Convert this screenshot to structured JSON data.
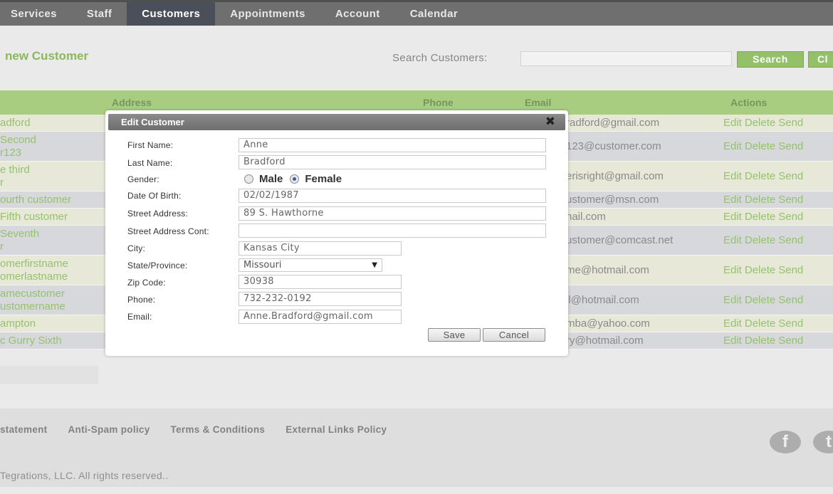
{
  "nav": {
    "items": [
      {
        "label": "Services",
        "active": false
      },
      {
        "label": "Staff",
        "active": false
      },
      {
        "label": "Customers",
        "active": true
      },
      {
        "label": "Appointments",
        "active": false
      },
      {
        "label": "Account",
        "active": false
      },
      {
        "label": "Calendar",
        "active": false
      }
    ]
  },
  "page": {
    "add_link": "new Customer",
    "search_label": "Search Customers:",
    "search_value": "",
    "search_button": "Search",
    "clear_button": "Cl"
  },
  "table": {
    "headers": {
      "address": "Address",
      "phone": "Phone",
      "email": "Email",
      "actions": "Actions"
    },
    "actions": [
      "Edit",
      "Delete",
      "Send"
    ],
    "rows": [
      {
        "name": [
          "adford"
        ],
        "email": "radford@gmail.com"
      },
      {
        "name": [
          "Second",
          "r123"
        ],
        "email": "123@customer.com"
      },
      {
        "name": [
          "e third",
          "r"
        ],
        "email": "erisright@gmail.com"
      },
      {
        "name": [
          "ourth customer"
        ],
        "email": "ustomer@msn.com"
      },
      {
        "name": [
          "Fifth customer"
        ],
        "email": "nail.com"
      },
      {
        "name": [
          "Seventh",
          "r"
        ],
        "email": "ustomer@comcast.net"
      },
      {
        "name": [
          "omerfirstname",
          "omerlastname"
        ],
        "email": "me@hotmail.com"
      },
      {
        "name": [
          "amecustomer",
          "ustomername"
        ],
        "email": "il@hotmail.com"
      },
      {
        "name": [
          "ampton"
        ],
        "email": "mba@yahoo.com"
      },
      {
        "name": [
          "c Gurry Sixth"
        ],
        "email": "ry@hotmail.com"
      }
    ]
  },
  "footer": {
    "links": [
      "statement",
      "Anti-Spam policy",
      "Terms & Conditions",
      "External Links Policy"
    ],
    "copyright": "Tegrations, LLC. All rights reserved..",
    "social": [
      "f",
      "t"
    ]
  },
  "modal": {
    "title": "Edit Customer",
    "labels": {
      "first_name": "First Name:",
      "last_name": "Last Name:",
      "gender": "Gender:",
      "dob": "Date Of Birth:",
      "street": "Street Address:",
      "street2": "Street Address Cont:",
      "city": "City:",
      "state": "State/Province:",
      "zip": "Zip Code:",
      "phone": "Phone:",
      "email": "Email:"
    },
    "values": {
      "first_name": "Anne",
      "last_name": "Bradford",
      "dob": "02/02/1987",
      "street": "89 S. Hawthorne",
      "street2": "",
      "city": "Kansas City",
      "state": "Missouri",
      "zip": "30938",
      "phone": "732-232-0192",
      "email": "Anne.Bradford@gmail.com"
    },
    "gender_options": {
      "male": "Male",
      "female": "Female",
      "selected": "Female"
    },
    "save": "Save",
    "cancel": "Cancel"
  }
}
